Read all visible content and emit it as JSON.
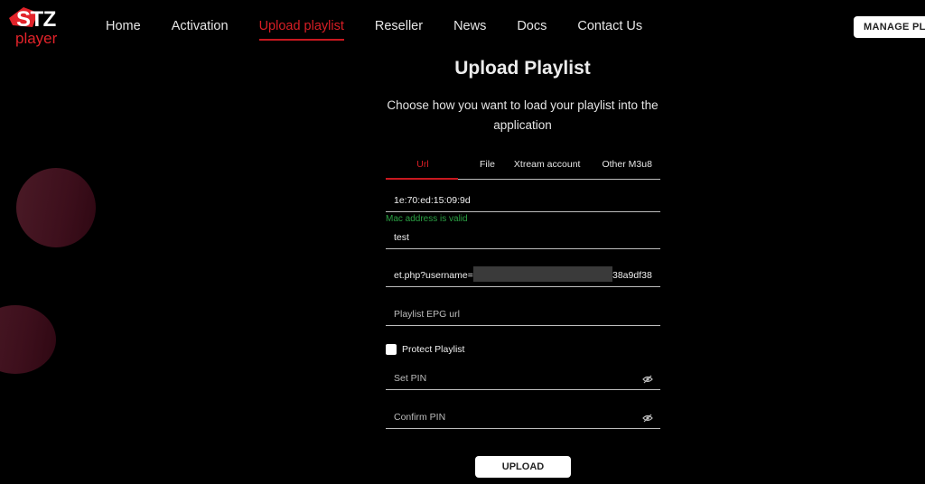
{
  "brand": {
    "logo_main": "STZ",
    "logo_sub": "player"
  },
  "nav": {
    "items": [
      {
        "label": "Home",
        "active": false
      },
      {
        "label": "Activation",
        "active": false
      },
      {
        "label": "Upload playlist",
        "active": true
      },
      {
        "label": "Reseller",
        "active": false
      },
      {
        "label": "News",
        "active": false
      },
      {
        "label": "Docs",
        "active": false
      },
      {
        "label": "Contact Us",
        "active": false
      }
    ],
    "manage_button": "MANAGE PLAYLIST"
  },
  "page": {
    "title": "Upload Playlist",
    "subtitle": "Choose how you want to load your playlist into the application"
  },
  "tabs": [
    {
      "label": "Url",
      "active": true
    },
    {
      "label": "File",
      "active": false
    },
    {
      "label": "Xtream account",
      "active": false
    },
    {
      "label": "Other M3u8",
      "active": false
    }
  ],
  "form": {
    "mac_address": {
      "value": "1e:70:ed:15:09:9d",
      "validation": "Mac address is valid"
    },
    "playlist_name": {
      "value": "test"
    },
    "playlist_url": {
      "value_prefix": "et.php?username=",
      "value_suffix": "38a9df38",
      "redacted": true
    },
    "epg_url": {
      "placeholder": "Playlist EPG url",
      "value": ""
    },
    "protect_playlist": {
      "label": "Protect Playlist",
      "checked": false
    },
    "set_pin": {
      "placeholder": "Set PIN",
      "icon": "eye-slash-icon"
    },
    "confirm_pin": {
      "placeholder": "Confirm PIN",
      "icon": "eye-slash-icon"
    },
    "upload_button": "UPLOAD"
  },
  "colors": {
    "accent": "#d81e25",
    "valid": "#2aa043",
    "background": "#000000"
  }
}
